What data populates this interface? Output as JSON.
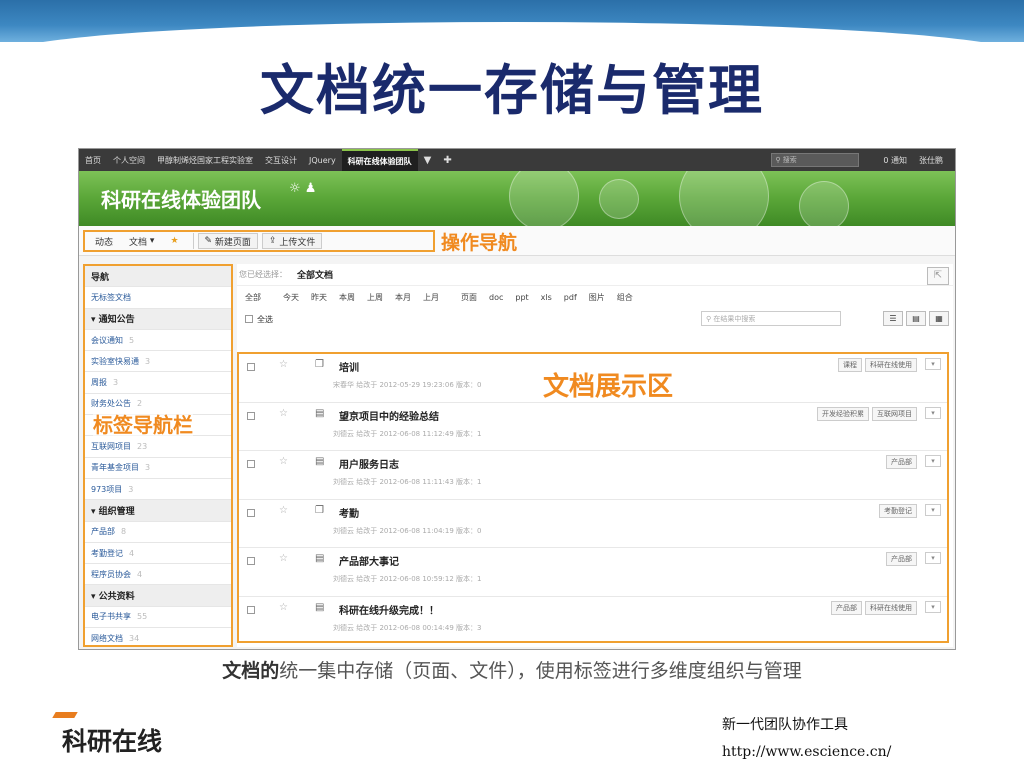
{
  "slide": {
    "title": "文档统一存储与管理",
    "caption_bold": "文档的",
    "caption_rest": "统一集中存储（页面、文件），使用标签进行多维度组织与管理",
    "footer_logo": "科研在线",
    "footer_tagline": "新一代团队协作工具",
    "footer_url": "http://www.escience.cn/"
  },
  "annotations": {
    "op_nav": "操作导航",
    "tag_nav": "标签导航栏",
    "doc_area": "文档展示区"
  },
  "topbar": {
    "items": [
      "首页",
      "个人空间",
      "甲醇制烯烃国家工程实验室",
      "交互设计",
      "JQuery"
    ],
    "active": "科研在线体验团队",
    "dropdown_icon": "▼",
    "add_icon": "✚",
    "search_placeholder": "搜索",
    "notice": "0 通知",
    "user": "张仕鹏"
  },
  "banner": {
    "team_name": "科研在线体验团队"
  },
  "subnav": {
    "activity": "动态",
    "docs": "文档",
    "new_page": "新建页面",
    "upload": "上传文件"
  },
  "sidebar": {
    "items": [
      {
        "label": "导航",
        "head": true,
        "count": ""
      },
      {
        "label": "无标签文档",
        "head": false,
        "count": ""
      },
      {
        "label": "▾ 通知公告",
        "head": true,
        "count": ""
      },
      {
        "label": "会议通知",
        "head": false,
        "count": "5"
      },
      {
        "label": "实验室快易通",
        "head": false,
        "count": "3"
      },
      {
        "label": "周报",
        "head": false,
        "count": "3"
      },
      {
        "label": "财务处公告",
        "head": false,
        "count": "2"
      },
      {
        "label": "",
        "head": false,
        "count": ""
      },
      {
        "label": "互联网项目",
        "head": false,
        "count": "23"
      },
      {
        "label": "青年基金项目",
        "head": false,
        "count": "3"
      },
      {
        "label": "973项目",
        "head": false,
        "count": "3"
      },
      {
        "label": "▾ 组织管理",
        "head": true,
        "count": ""
      },
      {
        "label": "产品部",
        "head": false,
        "count": "8"
      },
      {
        "label": "考勤登记",
        "head": false,
        "count": "4"
      },
      {
        "label": "程序员协会",
        "head": false,
        "count": "4"
      },
      {
        "label": "▾ 公共资料",
        "head": true,
        "count": ""
      },
      {
        "label": "电子书共享",
        "head": false,
        "count": "55"
      },
      {
        "label": "网络文档",
        "head": false,
        "count": "34"
      }
    ]
  },
  "main": {
    "crumb_label": "您已经选择：",
    "crumb_value": "全部文档",
    "filters": [
      "全部",
      "今天",
      "昨天",
      "本周",
      "上周",
      "本月",
      "上月",
      "页面",
      "doc",
      "ppt",
      "xls",
      "pdf",
      "图片",
      "组合"
    ],
    "select_all": "全选",
    "list_search_placeholder": "在结果中搜索",
    "docs": [
      {
        "title": "培训",
        "meta": "宋春华 给改于 2012-05-29 19:23:06    版本：0",
        "tags": [
          "课程",
          "科研在线使用"
        ],
        "type": "folder"
      },
      {
        "title": "望京项目中的经验总结",
        "meta": "刘德云 给改于 2012-06-08 11:12:49    版本：1",
        "tags": [
          "开发经验积累",
          "互联网项目"
        ],
        "type": "page"
      },
      {
        "title": "用户服务日志",
        "meta": "刘德云 给改于 2012-06-08 11:11:43    版本：1",
        "tags": [
          "产品部"
        ],
        "type": "page"
      },
      {
        "title": "考勤",
        "meta": "刘德云 给改于 2012-06-08 11:04:19    版本：0",
        "tags": [
          "考勤登记"
        ],
        "type": "folder"
      },
      {
        "title": "产品部大事记",
        "meta": "刘德云 给改于 2012-06-08 10:59:12    版本：1",
        "tags": [
          "产品部"
        ],
        "type": "page"
      },
      {
        "title": "科研在线升级完成！！",
        "meta": "刘德云 给改于 2012-06-08 00:14:49    版本：3",
        "tags": [
          "产品部",
          "科研在线使用"
        ],
        "type": "page"
      }
    ]
  },
  "colors": {
    "accent": "#f08a20",
    "title": "#1a2a6c",
    "banner": "#5aa638"
  }
}
